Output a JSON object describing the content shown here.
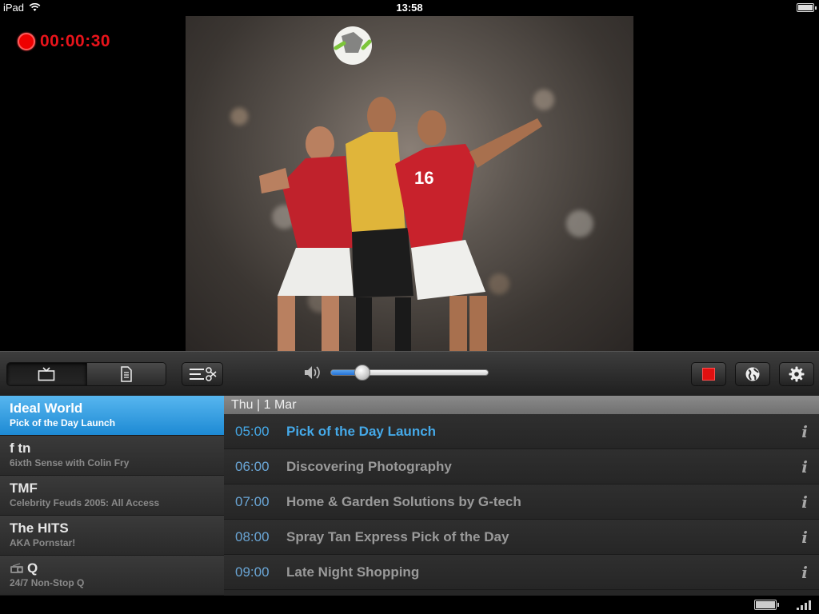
{
  "status_bar": {
    "device": "iPad",
    "time": "13:58"
  },
  "recording": {
    "time": "00:00:30",
    "color": "#e8141b"
  },
  "toolbar": {
    "segments": [
      {
        "icon": "tv-icon",
        "active": true
      },
      {
        "icon": "document-icon",
        "active": false
      }
    ],
    "volume": 0.2
  },
  "channels": [
    {
      "name": "Ideal World",
      "program": "Pick of the Day Launch",
      "active": true
    },
    {
      "name": "f tn",
      "program": "6ixth Sense with Colin Fry",
      "active": false
    },
    {
      "name": "TMF",
      "program": "Celebrity Feuds 2005: All Access",
      "active": false
    },
    {
      "name": "The HITS",
      "program": "AKA Pornstar!",
      "active": false
    },
    {
      "name": "Q",
      "program": "24/7 Non-Stop Q",
      "active": false,
      "icon": "radio-icon"
    }
  ],
  "schedule": {
    "date": "Thu | 1 Mar",
    "rows": [
      {
        "time": "05:00",
        "title": "Pick of the Day Launch",
        "current": true,
        "info": "i"
      },
      {
        "time": "06:00",
        "title": "Discovering Photography",
        "current": false,
        "info": "i"
      },
      {
        "time": "07:00",
        "title": "Home & Garden Solutions by G-tech",
        "current": false,
        "info": "i"
      },
      {
        "time": "08:00",
        "title": "Spray Tan Express Pick of the Day",
        "current": false,
        "info": "i"
      },
      {
        "time": "09:00",
        "title": "Late Night Shopping",
        "current": false,
        "info": "i"
      }
    ]
  },
  "colors": {
    "accent": "#45a9e8",
    "record": "#e01010"
  }
}
